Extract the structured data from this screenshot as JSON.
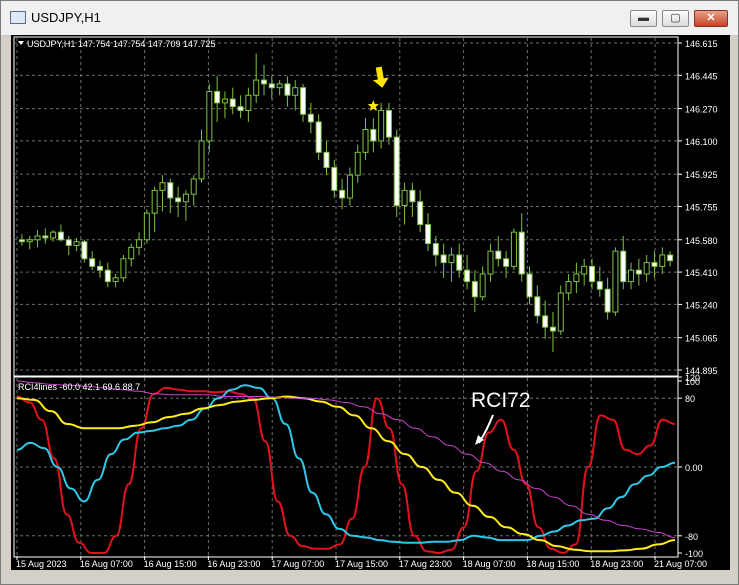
{
  "window": {
    "title": "USDJPY,H1",
    "icon": "chart-window-icon",
    "buttons": [
      {
        "name": "minimize-button",
        "icon": "minimize-icon",
        "glyph": "▬"
      },
      {
        "name": "maximize-button",
        "icon": "restore-icon",
        "glyph": "▢"
      },
      {
        "name": "close-button",
        "icon": "close-icon",
        "glyph": "✕"
      }
    ]
  },
  "colors": {
    "background": "#000000",
    "grid": "#6e6e6e",
    "candle": "#7ec242",
    "candle_bull_fill": "#000000",
    "candle_bear_fill": "#ffffff",
    "axis_text": "#ffffff",
    "marker": "#ffe600",
    "rci_short": "#e0121c",
    "rci_mid": "#2ec8e8",
    "rci_long": "#ffec19",
    "rci_extra": "#cc44cc",
    "annotation": "#ffffff"
  },
  "chart_data": [
    {
      "type": "candlestick",
      "info_label": "USDJPY,H1  147.754 147.754 147.709 147.725",
      "ylim": [
        144.895,
        146.615
      ],
      "y_ticks": [
        "146.615",
        "146.445",
        "146.270",
        "146.100",
        "145.925",
        "145.755",
        "145.580",
        "145.410",
        "145.240",
        "145.065",
        "144.895"
      ],
      "x_ticks": [
        "15 Aug 2023",
        "16 Aug 07:00",
        "16 Aug 15:00",
        "16 Aug 23:00",
        "17 Aug 07:00",
        "17 Aug 15:00",
        "17 Aug 23:00",
        "18 Aug 07:00",
        "18 Aug 15:00",
        "18 Aug 23:00",
        "21 Aug 07:00"
      ],
      "candles": [
        [
          145.58,
          145.61,
          145.55,
          145.57
        ],
        [
          145.57,
          145.6,
          145.53,
          145.58
        ],
        [
          145.58,
          145.63,
          145.54,
          145.6
        ],
        [
          145.6,
          145.64,
          145.56,
          145.59
        ],
        [
          145.59,
          145.63,
          145.57,
          145.62
        ],
        [
          145.62,
          145.66,
          145.57,
          145.58
        ],
        [
          145.58,
          145.6,
          145.5,
          145.55
        ],
        [
          145.55,
          145.59,
          145.52,
          145.57
        ],
        [
          145.57,
          145.58,
          145.46,
          145.48
        ],
        [
          145.48,
          145.52,
          145.42,
          145.44
        ],
        [
          145.44,
          145.47,
          145.38,
          145.42
        ],
        [
          145.42,
          145.46,
          145.33,
          145.36
        ],
        [
          145.36,
          145.4,
          145.33,
          145.38
        ],
        [
          145.38,
          145.5,
          145.36,
          145.48
        ],
        [
          145.48,
          145.56,
          145.44,
          145.54
        ],
        [
          145.54,
          145.62,
          145.5,
          145.58
        ],
        [
          145.58,
          145.74,
          145.56,
          145.72
        ],
        [
          145.72,
          145.86,
          145.62,
          145.84
        ],
        [
          145.84,
          145.92,
          145.73,
          145.88
        ],
        [
          145.88,
          145.9,
          145.72,
          145.8
        ],
        [
          145.8,
          145.86,
          145.7,
          145.78
        ],
        [
          145.78,
          145.84,
          145.68,
          145.82
        ],
        [
          145.82,
          145.92,
          145.76,
          145.9
        ],
        [
          145.9,
          146.16,
          145.88,
          146.1
        ],
        [
          146.1,
          146.4,
          146.04,
          146.36
        ],
        [
          146.36,
          146.44,
          146.2,
          146.3
        ],
        [
          146.3,
          146.36,
          146.22,
          146.32
        ],
        [
          146.32,
          146.38,
          146.24,
          146.28
        ],
        [
          146.28,
          146.34,
          146.22,
          146.26
        ],
        [
          146.26,
          146.38,
          146.2,
          146.34
        ],
        [
          146.34,
          146.56,
          146.3,
          146.42
        ],
        [
          146.42,
          146.5,
          146.34,
          146.4
        ],
        [
          146.4,
          146.44,
          146.32,
          146.38
        ],
        [
          146.38,
          146.42,
          146.34,
          146.4
        ],
        [
          146.4,
          146.44,
          146.28,
          146.34
        ],
        [
          146.34,
          146.42,
          146.26,
          146.38
        ],
        [
          146.38,
          146.4,
          146.2,
          146.24
        ],
        [
          146.24,
          146.3,
          146.14,
          146.2
        ],
        [
          146.2,
          146.24,
          146.0,
          146.04
        ],
        [
          146.04,
          146.1,
          145.92,
          145.96
        ],
        [
          145.96,
          146.0,
          145.8,
          145.84
        ],
        [
          145.84,
          145.9,
          145.74,
          145.8
        ],
        [
          145.8,
          145.96,
          145.76,
          145.92
        ],
        [
          145.92,
          146.08,
          145.88,
          146.04
        ],
        [
          146.04,
          146.22,
          146.0,
          146.16
        ],
        [
          146.16,
          146.22,
          146.04,
          146.1
        ],
        [
          146.1,
          146.3,
          146.06,
          146.26
        ],
        [
          146.26,
          146.3,
          146.08,
          146.12
        ],
        [
          146.12,
          146.16,
          145.7,
          145.76
        ],
        [
          145.76,
          145.88,
          145.66,
          145.84
        ],
        [
          145.84,
          145.88,
          145.7,
          145.78
        ],
        [
          145.78,
          145.84,
          145.62,
          145.66
        ],
        [
          145.66,
          145.72,
          145.52,
          145.56
        ],
        [
          145.56,
          145.6,
          145.44,
          145.5
        ],
        [
          145.5,
          145.56,
          145.38,
          145.46
        ],
        [
          145.46,
          145.54,
          145.36,
          145.5
        ],
        [
          145.5,
          145.56,
          145.38,
          145.42
        ],
        [
          145.42,
          145.5,
          145.32,
          145.36
        ],
        [
          145.36,
          145.42,
          145.2,
          145.28
        ],
        [
          145.28,
          145.44,
          145.26,
          145.4
        ],
        [
          145.4,
          145.56,
          145.36,
          145.52
        ],
        [
          145.52,
          145.6,
          145.44,
          145.48
        ],
        [
          145.48,
          145.52,
          145.38,
          145.44
        ],
        [
          145.44,
          145.64,
          145.42,
          145.62
        ],
        [
          145.62,
          145.72,
          145.36,
          145.4
        ],
        [
          145.4,
          145.44,
          145.24,
          145.28
        ],
        [
          145.28,
          145.34,
          145.14,
          145.18
        ],
        [
          145.18,
          145.26,
          145.06,
          145.12
        ],
        [
          145.12,
          145.2,
          144.99,
          145.1
        ],
        [
          145.1,
          145.34,
          145.08,
          145.3
        ],
        [
          145.3,
          145.4,
          145.26,
          145.36
        ],
        [
          145.36,
          145.46,
          145.3,
          145.4
        ],
        [
          145.4,
          145.48,
          145.34,
          145.44
        ],
        [
          145.44,
          145.48,
          145.32,
          145.36
        ],
        [
          145.36,
          145.44,
          145.28,
          145.32
        ],
        [
          145.32,
          145.38,
          145.16,
          145.2
        ],
        [
          145.2,
          145.54,
          145.18,
          145.52
        ],
        [
          145.52,
          145.6,
          145.32,
          145.36
        ],
        [
          145.36,
          145.46,
          145.32,
          145.42
        ],
        [
          145.42,
          145.48,
          145.34,
          145.4
        ],
        [
          145.4,
          145.5,
          145.36,
          145.46
        ],
        [
          145.46,
          145.52,
          145.38,
          145.44
        ],
        [
          145.44,
          145.54,
          145.4,
          145.5
        ],
        [
          145.5,
          145.52,
          145.44,
          145.47
        ]
      ],
      "markers": [
        {
          "kind": "arrow",
          "candle": 46
        },
        {
          "kind": "star",
          "candle": 45
        }
      ]
    },
    {
      "type": "line",
      "info_label": "RCI4lines -60.0 42.1 69.6 88.7",
      "ylim": [
        -100,
        100
      ],
      "y_ticks": [
        "120",
        "100",
        "80",
        "0.00",
        "-80",
        "-100"
      ],
      "annotation": "RCI72",
      "series": [
        {
          "color_key": "rci_short",
          "values": [
            82,
            75,
            55,
            10,
            -55,
            -88,
            -100,
            -100,
            -80,
            -20,
            45,
            85,
            92,
            90,
            88,
            88,
            87,
            88,
            85,
            80,
            30,
            -40,
            -80,
            -92,
            -95,
            -95,
            -90,
            -60,
            0,
            80,
            45,
            -20,
            -80,
            -98,
            -100,
            -96,
            -70,
            -5,
            40,
            55,
            20,
            -20,
            -70,
            -95,
            -100,
            -90,
            0,
            60,
            55,
            20,
            15,
            25,
            55,
            50
          ]
        },
        {
          "color_key": "rci_mid",
          "values": [
            20,
            28,
            22,
            0,
            -25,
            -40,
            -15,
            15,
            32,
            40,
            42,
            45,
            48,
            55,
            68,
            80,
            90,
            95,
            92,
            80,
            50,
            10,
            -30,
            -55,
            -72,
            -80,
            -82,
            -85,
            -87,
            -88,
            -88,
            -87,
            -87,
            -85,
            -80,
            -82,
            -85,
            -85,
            -85,
            -80,
            -75,
            -68,
            -62,
            -60,
            -48,
            -35,
            -20,
            -10,
            0,
            5
          ]
        },
        {
          "color_key": "rci_long",
          "values": [
            80,
            78,
            65,
            50,
            45,
            45,
            45,
            48,
            52,
            58,
            62,
            68,
            72,
            76,
            78,
            80,
            82,
            80,
            76,
            70,
            60,
            45,
            30,
            15,
            0,
            -15,
            -30,
            -45,
            -58,
            -70,
            -78,
            -85,
            -92,
            -96,
            -98,
            -98,
            -97,
            -95,
            -90,
            -85
          ]
        },
        {
          "color_key": "rci_extra",
          "values": [
            100,
            98,
            96,
            95,
            94,
            92,
            90,
            88,
            85,
            84,
            84,
            84,
            82,
            82,
            82,
            81,
            80,
            80,
            78,
            75,
            70,
            62,
            55,
            45,
            35,
            25,
            15,
            5,
            -5,
            -15,
            -25,
            -35,
            -45,
            -55,
            -62,
            -68,
            -72,
            -76,
            -82
          ]
        }
      ]
    }
  ]
}
